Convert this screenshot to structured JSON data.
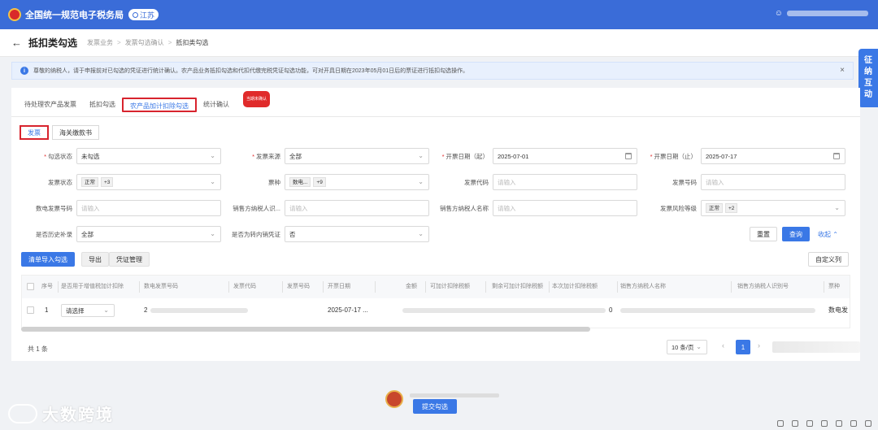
{
  "header": {
    "site_title": "全国统一规范电子税务局",
    "region": "江苏"
  },
  "page": {
    "title": "抵扣类勾选",
    "breadcrumbs": [
      "发票业务",
      "发票勾选确认",
      "抵扣类勾选"
    ]
  },
  "notice": {
    "text": "尊敬的纳税人，请于申报前对已勾选的凭证进行统计确认。农产品业务抵扣勾选和代扣代缴完税凭证勾选功能，可对开具日期在2023年05月01日后的票证进行抵扣勾选操作。",
    "close": "×"
  },
  "side_float": {
    "chars": [
      "征",
      "纳",
      "互",
      "动"
    ]
  },
  "tabs": [
    {
      "label": "待处理农产品发票"
    },
    {
      "label": "抵扣勾选"
    },
    {
      "label": "农产品加计扣除勾选"
    },
    {
      "label": "统计确认",
      "badge": "当期未确认"
    }
  ],
  "subtabs": [
    {
      "label": "发票"
    },
    {
      "label": "海关缴款书"
    }
  ],
  "filters": {
    "check_status": {
      "label": "勾选状态",
      "value": "未勾选"
    },
    "invoice_source": {
      "label": "发票来源",
      "value": "全部"
    },
    "date_start": {
      "label": "开票日期（起）",
      "value": "2025-07-01"
    },
    "date_end": {
      "label": "开票日期（止）",
      "value": "2025-07-17"
    },
    "invoice_status": {
      "label": "发票状态",
      "tag": "正常",
      "more": "+3"
    },
    "ticket_type": {
      "label": "票种",
      "tag": "数电...",
      "more": "+9"
    },
    "invoice_code": {
      "label": "发票代码",
      "placeholder": "请输入"
    },
    "invoice_number": {
      "label": "发票号码",
      "placeholder": "请输入"
    },
    "digital_invoice_number": {
      "label": "数电发票号码",
      "placeholder": "请输入"
    },
    "seller_tax_id": {
      "label": "销售方纳税人识...",
      "placeholder": "请输入"
    },
    "seller_name": {
      "label": "销售方纳税人名称",
      "placeholder": "请输入"
    },
    "risk_level": {
      "label": "发票风险等级",
      "tag": "正常",
      "more": "+2"
    },
    "history_supplement": {
      "label": "是否历史补录",
      "value": "全部"
    },
    "transfer_out": {
      "label": "是否为转内销凭证",
      "value": "否"
    }
  },
  "actions": {
    "reset": "重置",
    "query": "查询",
    "collapse": "收起"
  },
  "toolbar": {
    "import_select": "清单导入勾选",
    "export": "导出",
    "voucher_mgmt": "凭证管理",
    "custom_columns": "自定义列"
  },
  "table": {
    "headers": [
      "序号",
      "是否用于增值税加计扣除",
      "数电发票号码",
      "发票代码",
      "发票号码",
      "开票日期",
      "金额",
      "可加计扣除税额",
      "剩余可加计扣除税额",
      "本次加计扣除税额",
      "销售方纳税人名称",
      "销售方纳税人识别号",
      "票种"
    ],
    "rows": [
      {
        "index": "1",
        "select_placeholder": "请选择",
        "invoice_no": "2",
        "date": "2025-07-17 ...",
        "this_deduct": "0",
        "type": "数电发"
      }
    ]
  },
  "pagination": {
    "total": "共 1 条",
    "page_size": "10 条/页",
    "current": "1"
  },
  "footer": {
    "submit": "提交勾选"
  },
  "watermark": {
    "text": "大数跨境"
  },
  "colors": {
    "primary": "#3a78e6",
    "header": "#3a6cd8",
    "highlight": "#d8242e"
  }
}
